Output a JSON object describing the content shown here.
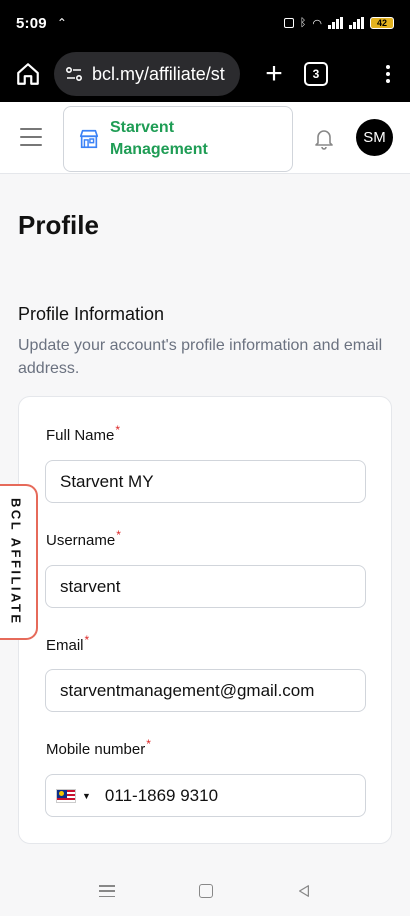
{
  "status_bar": {
    "time": "5:09",
    "battery": "42"
  },
  "browser": {
    "url": "bcl.my/affiliate/st",
    "tab_count": "3"
  },
  "header": {
    "org_name_line1": "Starvent",
    "org_name_line2": "Management",
    "avatar_initials": "SM"
  },
  "page": {
    "title": "Profile",
    "section_title": "Profile Information",
    "section_description": "Update your account's profile information and email address."
  },
  "form": {
    "full_name": {
      "label": "Full Name",
      "value": "Starvent MY"
    },
    "username": {
      "label": "Username",
      "value": "starvent"
    },
    "email": {
      "label": "Email",
      "value": "starventmanagement@gmail.com"
    },
    "mobile": {
      "label": "Mobile number",
      "value": "011-1869 9310"
    },
    "required_mark": "*"
  },
  "affiliate_tab": "BCL AFFILIATE",
  "colors": {
    "brand_green": "#1f9d55",
    "required_red": "#dc2626",
    "tab_border": "#e66a5a"
  }
}
